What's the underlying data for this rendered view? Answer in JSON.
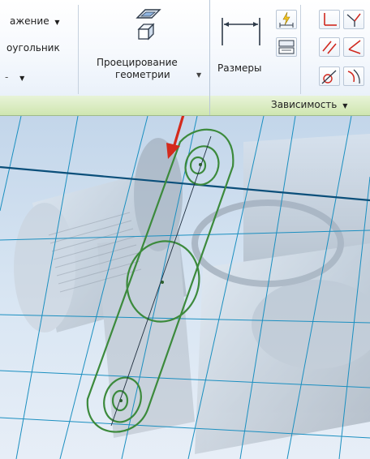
{
  "ribbon": {
    "partial_items": {
      "item1_label": "ажение",
      "item2_label": "оугольник"
    },
    "project_geometry": {
      "label_line1": "Проецирование",
      "label_line2": "геометрии"
    },
    "dimensions": {
      "label": "Размеры"
    },
    "group_bar": {
      "constraints_label": "Зависимость"
    }
  },
  "colors": {
    "sketch_curve": "#3c8a3c",
    "grid_line": "#1b8fc0",
    "axis_line": "#0b4f7a",
    "arrow": "#d42a1c",
    "group_bar": "#d7ebbd"
  }
}
